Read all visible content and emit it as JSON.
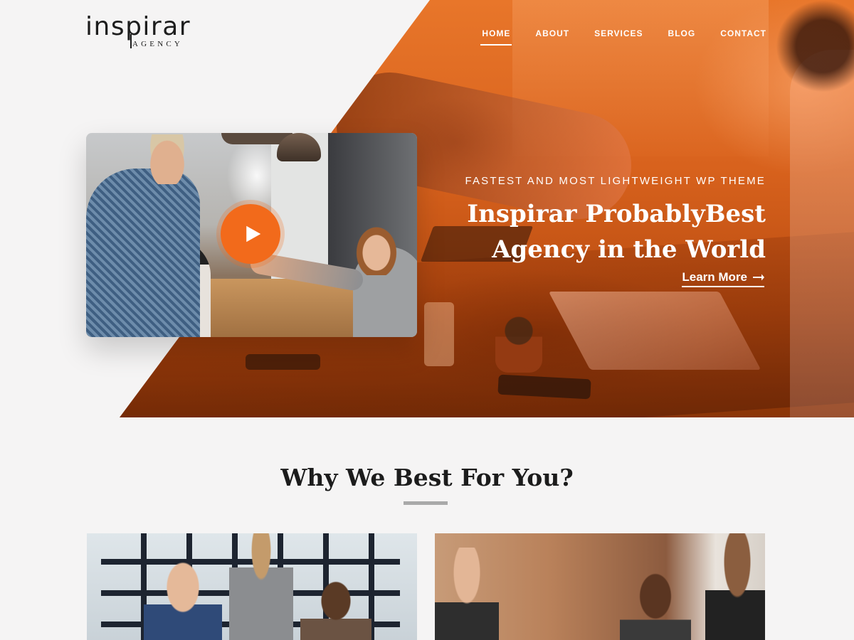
{
  "brand": {
    "name": "inspirar",
    "tagline": "AGENCY"
  },
  "nav": {
    "items": [
      {
        "label": "HOME",
        "active": true
      },
      {
        "label": "ABOUT",
        "active": false
      },
      {
        "label": "SERVICES",
        "active": false
      },
      {
        "label": "BLOG",
        "active": false
      },
      {
        "label": "CONTACT",
        "active": false
      }
    ]
  },
  "hero": {
    "eyebrow": "FASTEST AND MOST LIGHTWEIGHT WP THEME",
    "title_line1": "Inspirar ProbablyBest",
    "title_line2": "Agency in the World",
    "cta_label": "Learn More",
    "cta_icon": "arrow-right-icon",
    "video_icon": "play-icon"
  },
  "why": {
    "title": "Why We Best For You?"
  },
  "colors": {
    "accent": "#f26a1b",
    "hero_overlay": "#d8621d",
    "background": "#f5f4f4",
    "text_dark": "#1c1c1c",
    "underline": "#a9a9a9"
  }
}
